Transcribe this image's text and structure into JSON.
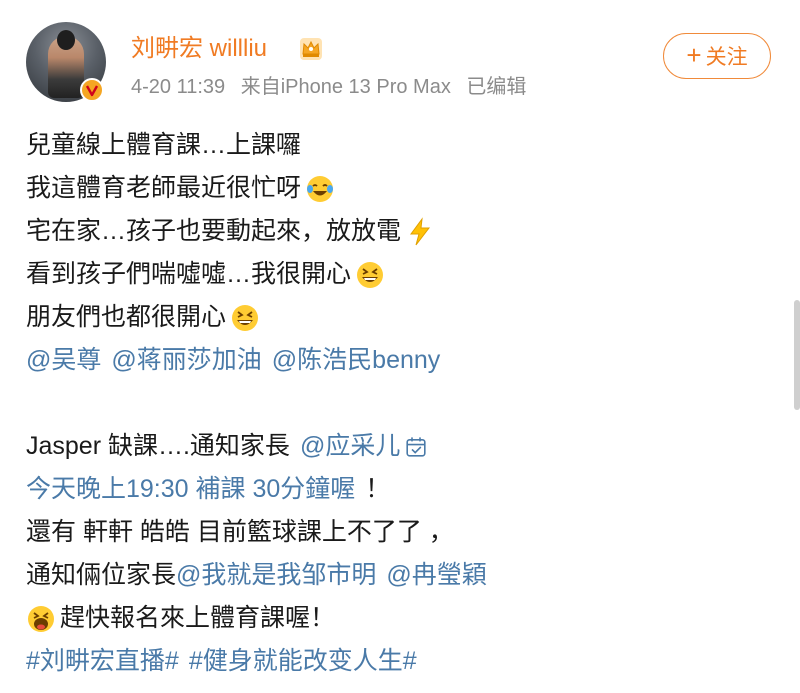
{
  "post": {
    "author": "刘畊宏 willliu",
    "time": "4-20 11:39",
    "source": "来自iPhone 13 Pro Max",
    "edited": "已编辑",
    "follow_label": "关注",
    "lines": {
      "l1": "兒童線上體育課…上課囉",
      "l2": "我這體育老師最近很忙呀",
      "l3": "宅在家…孩子也要動起來，放放電",
      "l4": "看到孩子們喘噓噓…我很開心",
      "l5": "朋友們也都很開心",
      "mentions1": [
        "@吴尊",
        "@蒋丽莎加油",
        "@陈浩民benny"
      ],
      "l7_text": "Jasper 缺課….通知家長",
      "l7_mention": "@应采儿",
      "l8": "今天晚上19:30 補課 30分鐘喔",
      "l8_tail": "！",
      "l9": "還有 軒軒 皓皓 目前籃球課上不了了 ，",
      "l10_text": "通知倆位家長",
      "l10_mentions": [
        "@我就是我邹市明",
        "@冉瑩穎"
      ],
      "l11": "趕快報名來上體育課喔！",
      "hashtags": [
        "#刘畊宏直播#",
        "#健身就能改变人生#"
      ]
    }
  },
  "colors": {
    "accent": "#f07b23",
    "link": "#4a7aa8",
    "meta": "#8b8b8b"
  },
  "icons": [
    "verified-badge-icon",
    "crown-icon",
    "laughing-tears-emoji",
    "lightning-emoji",
    "grinning-squint-emoji",
    "laughing-open-mouth-emoji",
    "calendar-check-icon",
    "plus-icon"
  ]
}
